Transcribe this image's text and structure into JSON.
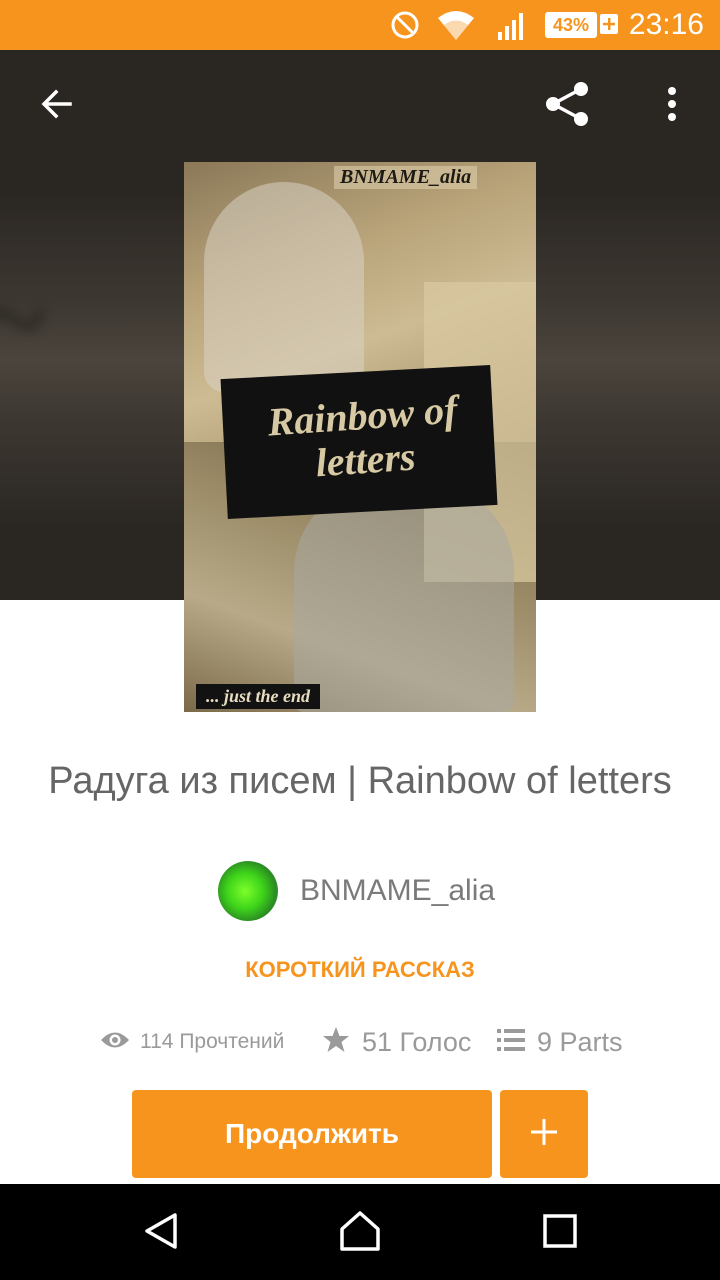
{
  "status_bar": {
    "battery": "43%",
    "time": "23:16",
    "icons": [
      "do-not-disturb-icon",
      "wifi-icon",
      "signal-icon",
      "battery-icon"
    ]
  },
  "toolbar": {
    "icons": [
      "back-arrow-icon",
      "share-icon",
      "more-vert-icon"
    ]
  },
  "cover": {
    "author_text": "BNMAME_alia",
    "title_text": "Rainbow of letters",
    "tagline": "... just the end"
  },
  "story": {
    "title": "Радуга из писем | Rainbow of letters",
    "author": "BNMAME_alia",
    "genre": "КОРОТКИЙ РАССКАЗ"
  },
  "stats": {
    "reads": "114 Прочтений",
    "votes": "51 Голос",
    "parts": "9 Parts",
    "icons": [
      "eye-icon",
      "star-icon",
      "list-icon"
    ]
  },
  "actions": {
    "continue_label": "Продолжить",
    "add_icon": "plus-icon"
  },
  "nav_bar": {
    "icons": [
      "back-triangle-icon",
      "home-icon",
      "recents-icon"
    ]
  },
  "colors": {
    "accent": "#f7941d",
    "text_gray": "#666666",
    "stat_gray": "#9a9a9a"
  }
}
